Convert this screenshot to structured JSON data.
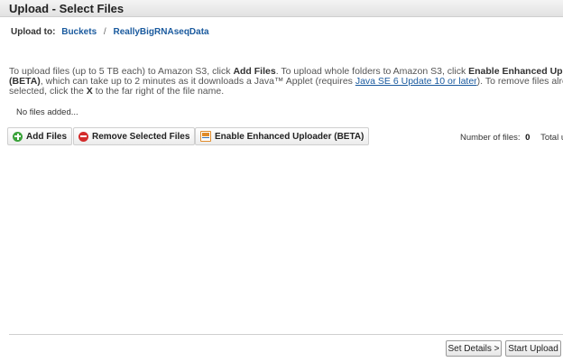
{
  "window": {
    "title": "Upload - Select Files"
  },
  "breadcrumb": {
    "prefix": "Upload to:",
    "buckets": "Buckets",
    "separator": "/",
    "bucket_name": "ReallyBigRNAseqData"
  },
  "instructions": {
    "l1_a": "To upload files (up to 5 TB each) to Amazon S3, click ",
    "l1_b": "Add Files",
    "l1_c": ". To upload whole folders to Amazon S3, click ",
    "l1_d": "Enable Enhanced Upload",
    "l2_a": "(BETA)",
    "l2_b": ", which can take up to 2 minutes as it downloads a Java™ Applet (requires ",
    "l2_link": "Java SE 6 Update 10 or later",
    "l2_c": "). To remove files alread",
    "l3_a": "selected, click the ",
    "l3_b": "X",
    "l3_c": " to the far right of the file name."
  },
  "file_list": {
    "empty_text": "No files added..."
  },
  "toolbar": {
    "add_files": "Add Files",
    "remove_selected": "Remove Selected Files",
    "enable_enhanced": "Enable Enhanced Uploader (BETA)"
  },
  "stats": {
    "num_files_label": "Number of files:",
    "num_files_value": "0",
    "total_label": "Total uplo"
  },
  "footer": {
    "set_details": "Set Details >",
    "start_upload": "Start Upload"
  },
  "icons": {
    "add": "plus-circle-icon",
    "remove": "minus-circle-icon",
    "java": "java-icon"
  },
  "colors": {
    "link": "#1a5a9e",
    "add": "#3aa23a",
    "remove": "#d32b2b"
  }
}
